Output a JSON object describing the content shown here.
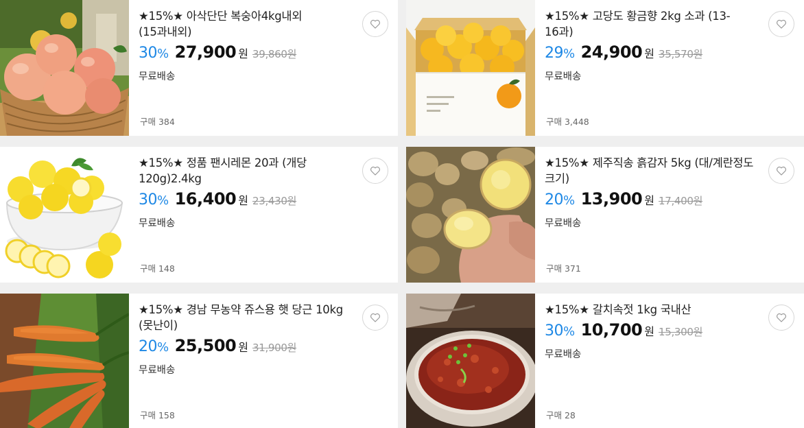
{
  "products": [
    {
      "title": "★15%★ 아삭단단 복숭아4kg내외 (15과내외)",
      "discount": "30",
      "discount_unit": "%",
      "price": "27,900",
      "currency": "원",
      "original_price": "39,860원",
      "shipping": "무료배송",
      "purchases": "구매 384",
      "image": "peach-basket"
    },
    {
      "title": "★15%★ 고당도 황금향 2kg 소과 (13-16과)",
      "discount": "29",
      "discount_unit": "%",
      "price": "24,900",
      "currency": "원",
      "original_price": "35,570원",
      "shipping": "무료배송",
      "purchases": "구매 3,448",
      "image": "orange-box"
    },
    {
      "title": "★15%★ 정품 팬시레몬 20과 (개당 120g)2.4kg",
      "discount": "30",
      "discount_unit": "%",
      "price": "16,400",
      "currency": "원",
      "original_price": "23,430원",
      "shipping": "무료배송",
      "purchases": "구매 148",
      "image": "lemon-bowl"
    },
    {
      "title": "★15%★ 제주직송 흙감자 5kg (대/계란정도 크기)",
      "discount": "20",
      "discount_unit": "%",
      "price": "13,900",
      "currency": "원",
      "original_price": "17,400원",
      "shipping": "무료배송",
      "purchases": "구매 371",
      "image": "potatoes"
    },
    {
      "title": "★15%★ 경남 무농약 쥬스용 햇 당근 10kg (못난이)",
      "discount": "20",
      "discount_unit": "%",
      "price": "25,500",
      "currency": "원",
      "original_price": "31,900원",
      "shipping": "무료배송",
      "purchases": "구매 158",
      "image": "carrots"
    },
    {
      "title": "★15%★ 갈치속젓 1kg 국내산",
      "discount": "30",
      "discount_unit": "%",
      "price": "10,700",
      "currency": "원",
      "original_price": "15,300원",
      "shipping": "무료배송",
      "purchases": "구매 28",
      "image": "jeotgal-bowl"
    }
  ],
  "colors": {
    "discount": "#1e88e5",
    "background": "#efefef",
    "card": "#ffffff"
  },
  "icons": {
    "wishlist": "heart-outline-icon"
  }
}
